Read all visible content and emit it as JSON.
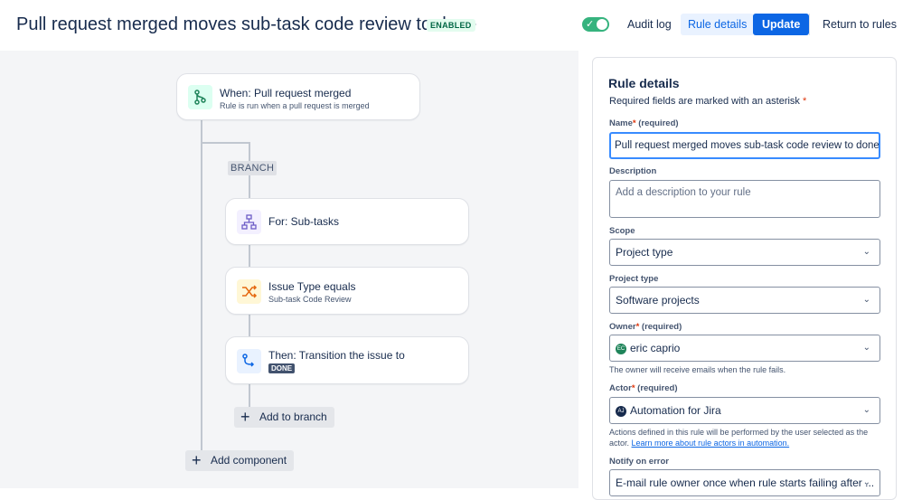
{
  "header": {
    "title": "Pull request merged moves sub-task code review to done",
    "status_badge": "ENABLED",
    "audit_log": "Audit log",
    "rule_details": "Rule details",
    "update": "Update",
    "return_to_rules": "Return to rules"
  },
  "flow": {
    "trigger": {
      "title": "When: Pull request merged",
      "subtitle": "Rule is run when a pull request is merged",
      "icon": "git-merge-icon"
    },
    "branch_label": "BRANCH",
    "branch_for": {
      "title": "For: Sub-tasks",
      "icon": "hierarchy-icon"
    },
    "condition": {
      "title": "Issue Type equals",
      "subtitle": "Sub-task Code Review",
      "icon": "shuffle-icon"
    },
    "action": {
      "title": "Then: Transition the issue to",
      "status": "DONE",
      "icon": "transition-icon"
    },
    "add_to_branch": "Add to branch",
    "add_component": "Add component"
  },
  "panel": {
    "title": "Rule details",
    "required_note": "Required fields are marked with an asterisk",
    "name_label": "Name",
    "name_required": "(required)",
    "name_value": "Pull request merged moves sub-task code review to done",
    "description_label": "Description",
    "description_placeholder": "Add a description to your rule",
    "scope_label": "Scope",
    "scope_value": "Project type",
    "project_type_label": "Project type",
    "project_type_value": "Software projects",
    "owner_label": "Owner",
    "owner_required": "(required)",
    "owner_value": "eric caprio",
    "owner_initials": "EC",
    "owner_helper": "The owner will receive emails when the rule fails.",
    "actor_label": "Actor",
    "actor_required": "(required)",
    "actor_value": "Automation for Jira",
    "actor_initials": "AJ",
    "actor_helper": "Actions defined in this rule will be performed by the user selected as the actor.",
    "actor_link": "Learn more about rule actors in automation.",
    "notify_label": "Notify on error",
    "notify_value": "E-mail rule owner once when rule starts failing after ..."
  },
  "colors": {
    "accent": "#0c66e4",
    "toggle_on": "#36b37e",
    "trigger_icon_bg": "#dcfff1",
    "branch_icon_bg": "#f3f0ff",
    "condition_icon_bg": "#fff7d6",
    "action_icon_bg": "#e9f2ff"
  }
}
